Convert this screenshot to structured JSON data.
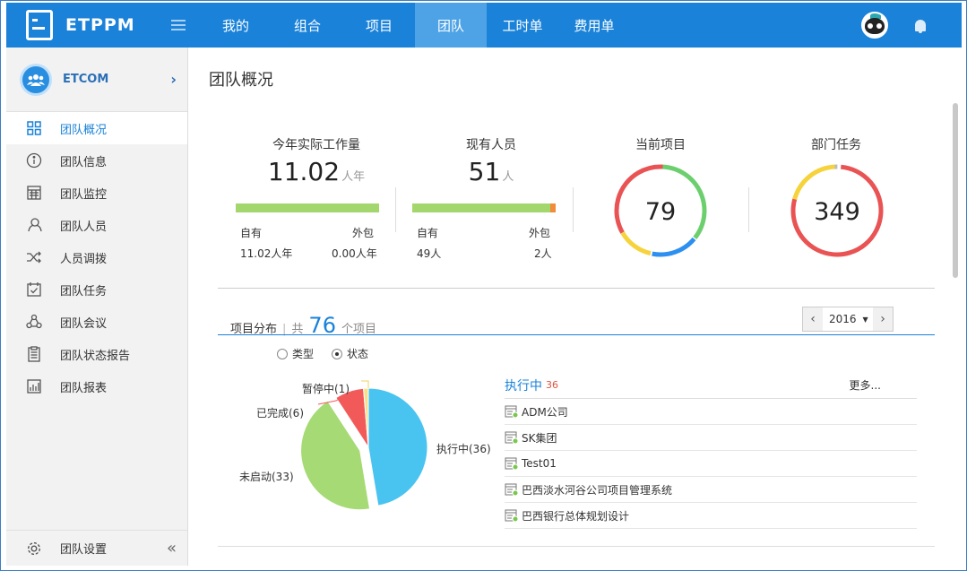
{
  "app": {
    "logo_text": "ETPPM",
    "nav": [
      "我的",
      "组合",
      "项目",
      "团队",
      "工时单",
      "费用单"
    ],
    "active_nav": "团队"
  },
  "sidebar": {
    "team_name": "ETCOM",
    "items": [
      {
        "label": "团队概况",
        "icon": "grid-icon",
        "active": true
      },
      {
        "label": "团队信息",
        "icon": "info-icon"
      },
      {
        "label": "团队监控",
        "icon": "calendar-icon"
      },
      {
        "label": "团队人员",
        "icon": "person-icon"
      },
      {
        "label": "人员调拨",
        "icon": "shuffle-icon"
      },
      {
        "label": "团队任务",
        "icon": "task-check-icon"
      },
      {
        "label": "团队会议",
        "icon": "meeting-icon"
      },
      {
        "label": "团队状态报告",
        "icon": "report-icon"
      },
      {
        "label": "团队报表",
        "icon": "chart-icon"
      }
    ],
    "footer_label": "团队设置"
  },
  "main": {
    "title": "团队概况",
    "workload": {
      "label": "今年实际工作量",
      "value": "11.02",
      "unit": "人年",
      "own_label": "自有",
      "out_label": "外包",
      "own_value": "11.02人年",
      "out_value": "0.00人年",
      "own_fraction": 1.0
    },
    "staff": {
      "label": "现有人员",
      "value": "51",
      "unit": "人",
      "own_label": "自有",
      "out_label": "外包",
      "own_value": "49人",
      "out_value": "2人",
      "own_fraction": 0.96
    },
    "projects": {
      "label": "当前项目",
      "value": "79"
    },
    "tasks": {
      "label": "部门任务",
      "value": "349"
    },
    "distribution": {
      "title": "项目分布",
      "total_prefix": "共",
      "total": "76",
      "total_suffix": "个项目",
      "year": "2016",
      "radio_type": "类型",
      "radio_status": "状态"
    },
    "pie": {
      "slices": [
        {
          "label": "执行中(36)",
          "value": 36,
          "color": "#49c3ef"
        },
        {
          "label": "未启动(33)",
          "value": 33,
          "color": "#a6da74"
        },
        {
          "label": "已完成(6)",
          "value": 6,
          "color": "#f25a5a"
        },
        {
          "label": "暂停中(1)",
          "value": 1,
          "color": "#f7e08c"
        }
      ]
    },
    "list": {
      "title": "执行中",
      "count": "36",
      "more": "更多...",
      "rows": [
        "ADM公司",
        "SK集团",
        "Test01",
        "巴西淡水河谷公司项目管理系统",
        "巴西银行总体规划设计"
      ]
    }
  },
  "colors": {
    "brand_blue": "#1a82d9",
    "bar_green": "#a3d66d",
    "bar_orange": "#f08c3a"
  }
}
